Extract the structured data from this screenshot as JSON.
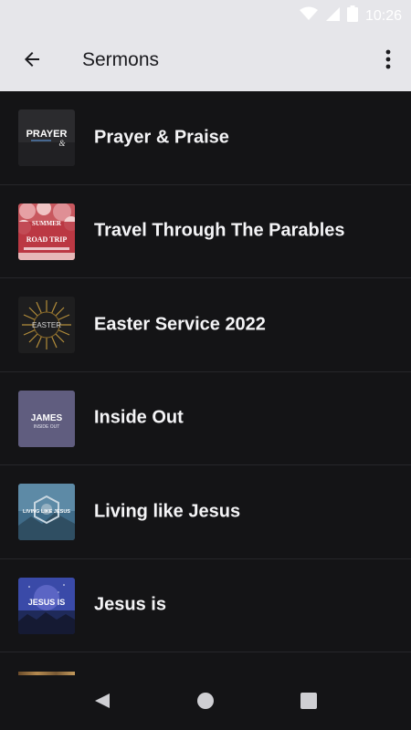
{
  "status": {
    "time": "10:26"
  },
  "header": {
    "title": "Sermons"
  },
  "items": [
    {
      "label": "Prayer & Praise",
      "thumb_icon": "prayer-praise-artwork",
      "thumb_text": "PRAYER"
    },
    {
      "label": "Travel Through The Parables",
      "thumb_icon": "summer-road-trip-artwork",
      "thumb_text": "SUMMER ROAD TRIP"
    },
    {
      "label": "Easter Service 2022",
      "thumb_icon": "easter-crown-artwork",
      "thumb_text": "EASTER"
    },
    {
      "label": "Inside Out",
      "thumb_icon": "james-inside-out-artwork",
      "thumb_text": "JAMES"
    },
    {
      "label": "Living like Jesus",
      "thumb_icon": "living-like-jesus-artwork",
      "thumb_text": "LIVING LIKE JESUS"
    },
    {
      "label": "Jesus is",
      "thumb_icon": "jesus-is-artwork",
      "thumb_text": "JESUS IS"
    }
  ],
  "colors": {
    "appbar_bg": "#e6e6ea",
    "list_bg": "#141416",
    "text_primary": "#f4f4f6"
  }
}
